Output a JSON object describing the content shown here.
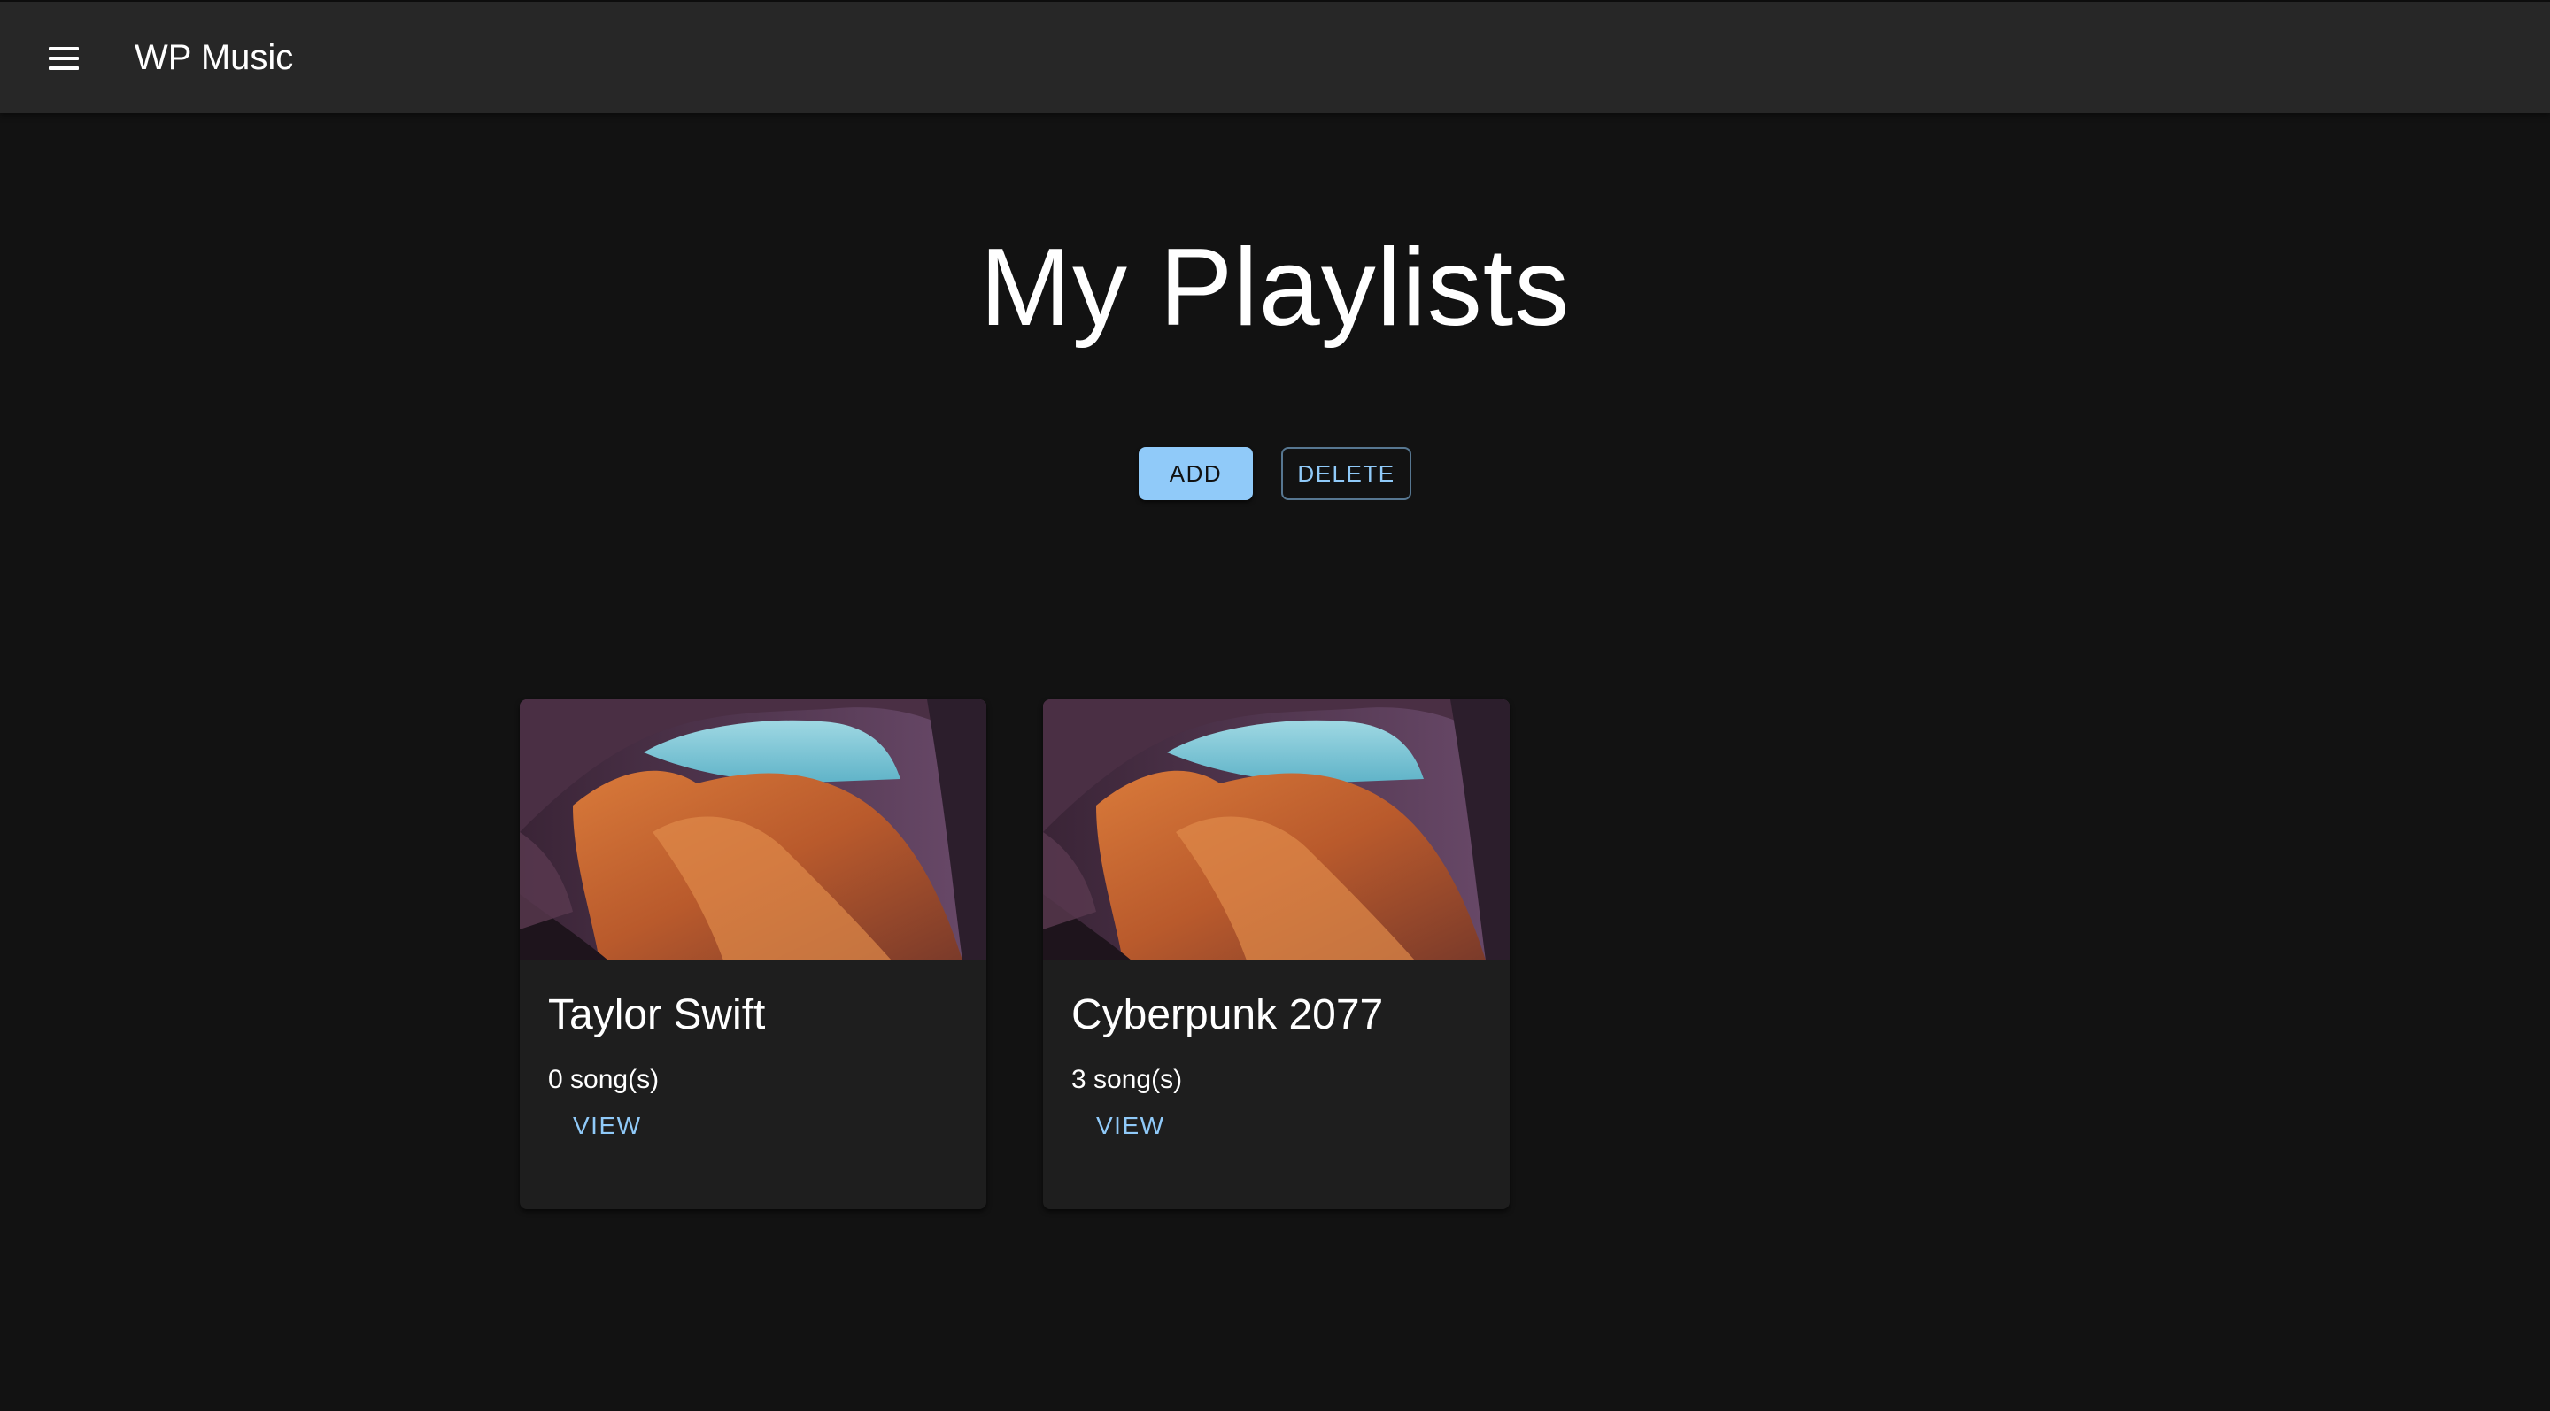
{
  "appbar": {
    "title": "WP Music",
    "menu_icon": "menu-icon"
  },
  "page": {
    "title": "My Playlists"
  },
  "actions": {
    "add_label": "ADD",
    "delete_label": "DELETE"
  },
  "playlists": [
    {
      "name": "Taylor Swift",
      "song_count": "0 song(s)",
      "view_label": "VIEW"
    },
    {
      "name": "Cyberpunk 2077",
      "song_count": "3 song(s)",
      "view_label": "VIEW"
    }
  ],
  "colors": {
    "background": "#121212",
    "appbar": "#272727",
    "card": "#1e1e1e",
    "primary": "#90caf9"
  }
}
